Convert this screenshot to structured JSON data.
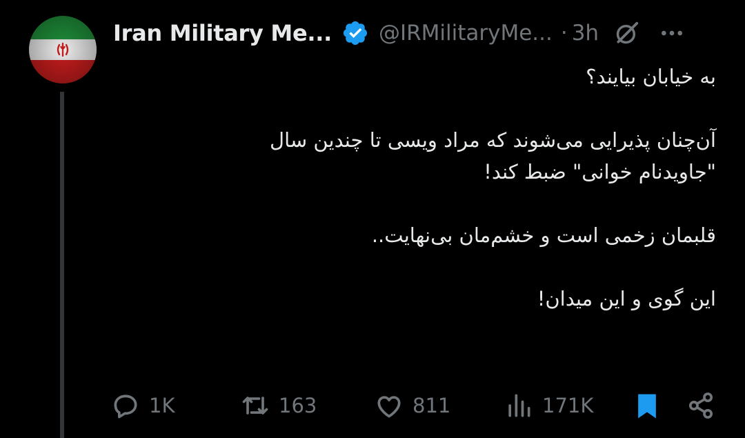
{
  "author": {
    "name": "Iran Military Me...",
    "handle": "@IRMilitaryMe...",
    "separator": "·",
    "time": "3h",
    "verified": true,
    "avatar_icon": "iran-flag-avatar"
  },
  "tweet": {
    "lines": [
      "به خیابان بیایند؟",
      "",
      "آن‌چنان پذیرایی می‌شوند که مراد ویسی تا چندین سال",
      "\"جاویدنام خوانی\" ضبط کند!",
      "",
      "قلبمان زخمی است و خشم‌مان بی‌نهایت..",
      "",
      "این گوی و این میدان!"
    ]
  },
  "actions": {
    "replies": "1K",
    "reposts": "163",
    "likes": "811",
    "views": "171K",
    "bookmarked": true
  },
  "colors": {
    "background": "#000000",
    "text": "#e7e9ea",
    "muted": "#71767b",
    "accent": "#1d9bf0",
    "flag_green": "#239f40",
    "flag_red": "#da0000",
    "flag_emblem": "#da0000"
  },
  "icons": {
    "verified": "verified-badge-icon",
    "grok": "grok-icon",
    "more": "more-icon",
    "reply": "reply-icon",
    "repost": "repost-icon",
    "like": "heart-icon",
    "views": "views-icon",
    "bookmark": "bookmark-icon",
    "share": "share-icon"
  }
}
